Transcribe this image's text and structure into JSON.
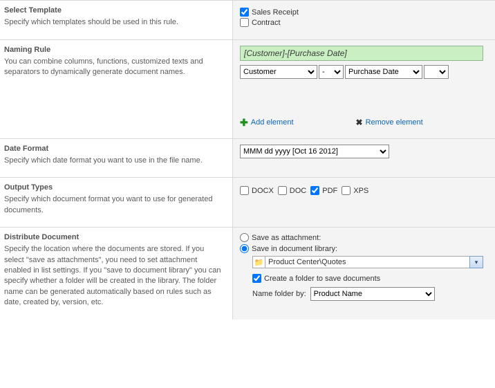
{
  "selectTemplate": {
    "title": "Select Template",
    "desc": "Specify which templates should be used in this rule.",
    "options": {
      "salesReceipt": {
        "label": "Sales Receipt",
        "checked": true
      },
      "contract": {
        "label": "Contract",
        "checked": false
      }
    }
  },
  "namingRule": {
    "title": "Naming Rule",
    "desc": "You can combine columns, functions, customized texts and separators to dynamically generate document names.",
    "preview": "[Customer]-[Purchase Date]",
    "selects": {
      "col1": "Customer",
      "sep": "-",
      "col2": "Purchase Date",
      "extra": ""
    },
    "addLabel": "Add element",
    "removeLabel": "Remove element"
  },
  "dateFormat": {
    "title": "Date Format",
    "desc": "Specify which date format you want to use in the file name.",
    "selected": "MMM dd yyyy  [Oct 16 2012]"
  },
  "outputTypes": {
    "title": "Output Types",
    "desc": "Specify which document format you want to use for generated documents.",
    "options": {
      "docx": {
        "label": "DOCX",
        "checked": false
      },
      "doc": {
        "label": "DOC",
        "checked": false
      },
      "pdf": {
        "label": "PDF",
        "checked": true
      },
      "xps": {
        "label": "XPS",
        "checked": false
      }
    }
  },
  "distribute": {
    "title": "Distribute Document",
    "desc": "Specify the location where the documents are stored. If you select \"save as attachments\", you need to set attachment enabled in list settings. If you \"save to document library\" you can specify whether a folder will be created in the library. The folder name can be generated automatically based on rules such as date, created by, version, etc.",
    "saveAttachmentLabel": "Save as attachment:",
    "saveLibraryLabel": "Save in document library:",
    "selectedMode": "library",
    "libraryPath": "Product Center\\Quotes",
    "createFolder": {
      "label": "Create a folder to save documents",
      "checked": true
    },
    "nameFolderLabel": "Name folder by:",
    "nameFolderValue": "Product Name"
  }
}
